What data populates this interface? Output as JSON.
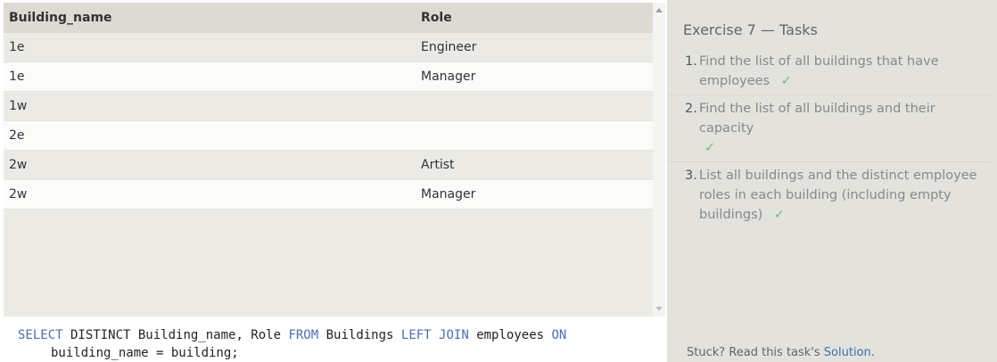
{
  "results": {
    "columns": [
      "Building_name",
      "Role"
    ],
    "rows": [
      [
        "1e",
        "Engineer"
      ],
      [
        "1e",
        "Manager"
      ],
      [
        "1w",
        ""
      ],
      [
        "2e",
        ""
      ],
      [
        "2w",
        "Artist"
      ],
      [
        "2w",
        "Manager"
      ]
    ]
  },
  "editor": {
    "kw_select": "SELECT",
    "t1": " DISTINCT Building_name, Role ",
    "kw_from": "FROM",
    "t2": " Buildings ",
    "kw_left": "LEFT",
    "t3": " ",
    "kw_join": "JOIN",
    "t4": " employees ",
    "kw_on": "ON",
    "line2": "building_name = building;"
  },
  "exercise": {
    "title": "Exercise 7 — Tasks",
    "tasks": [
      {
        "num": "1.",
        "text": "Find the list of all buildings that have employees",
        "done": "✓"
      },
      {
        "num": "2.",
        "text": "Find the list of all buildings and their capacity",
        "done": "✓"
      },
      {
        "num": "3.",
        "text": "List all buildings and the distinct employee roles in each building (including empty buildings)",
        "done": "✓"
      }
    ]
  },
  "footer": {
    "stuck_text": "Stuck? Read this task's ",
    "solution_link": "Solution",
    "period": "."
  },
  "icons": {
    "scroll_up": "arrow-up-icon",
    "scroll_down": "arrow-down-icon",
    "check": "checkmark-icon"
  },
  "colors": {
    "keyword": "#4a6fb1",
    "check": "#6cbf6c",
    "link": "#3a6fb1",
    "panel": "#e3e2dc"
  }
}
